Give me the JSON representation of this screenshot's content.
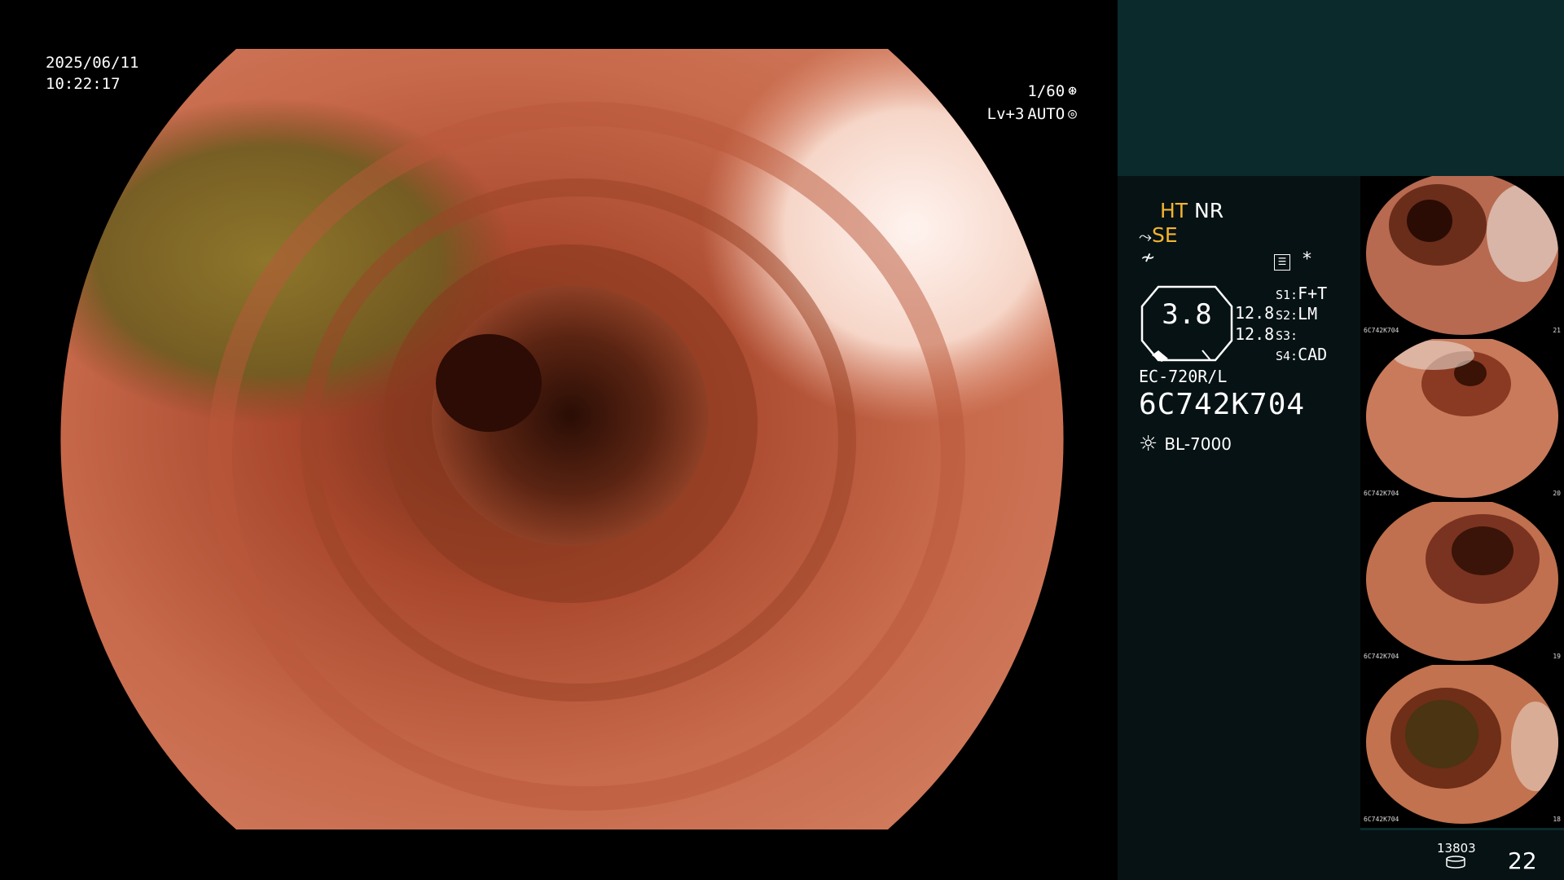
{
  "overlay": {
    "date": "2025/06/11",
    "time": "10:22:17",
    "shutter": "1/60",
    "shutter_icon": "aperture-icon",
    "level": "Lv+3",
    "mode": "AUTO",
    "mode_icon": "iris-icon"
  },
  "hud": {
    "ht": "HT",
    "nr": "NR",
    "se": "SE",
    "zoom": "3.8",
    "val1": "12.8",
    "val2": "12.8",
    "s1_key": "S1:",
    "s1_val": "F+T",
    "s2_key": "S2:",
    "s2_val": "LM",
    "s3_key": "S3:",
    "s3_val": "",
    "s4_key": "S4:",
    "s4_val": "CAD",
    "star": "*",
    "model": "EC-720R/L",
    "serial": "6C742K704",
    "lamp": "BL-7000"
  },
  "thumbnails": [
    {
      "label": "6C742K704",
      "index": "21"
    },
    {
      "label": "6C742K704",
      "index": "20"
    },
    {
      "label": "6C742K704",
      "index": "19"
    },
    {
      "label": "6C742K704",
      "index": "18"
    }
  ],
  "footer": {
    "count": "13803",
    "page": "22"
  },
  "colors": {
    "accent": "#f2b531",
    "panel_bg": "#071214",
    "panel_top": "#0b2a2c"
  }
}
